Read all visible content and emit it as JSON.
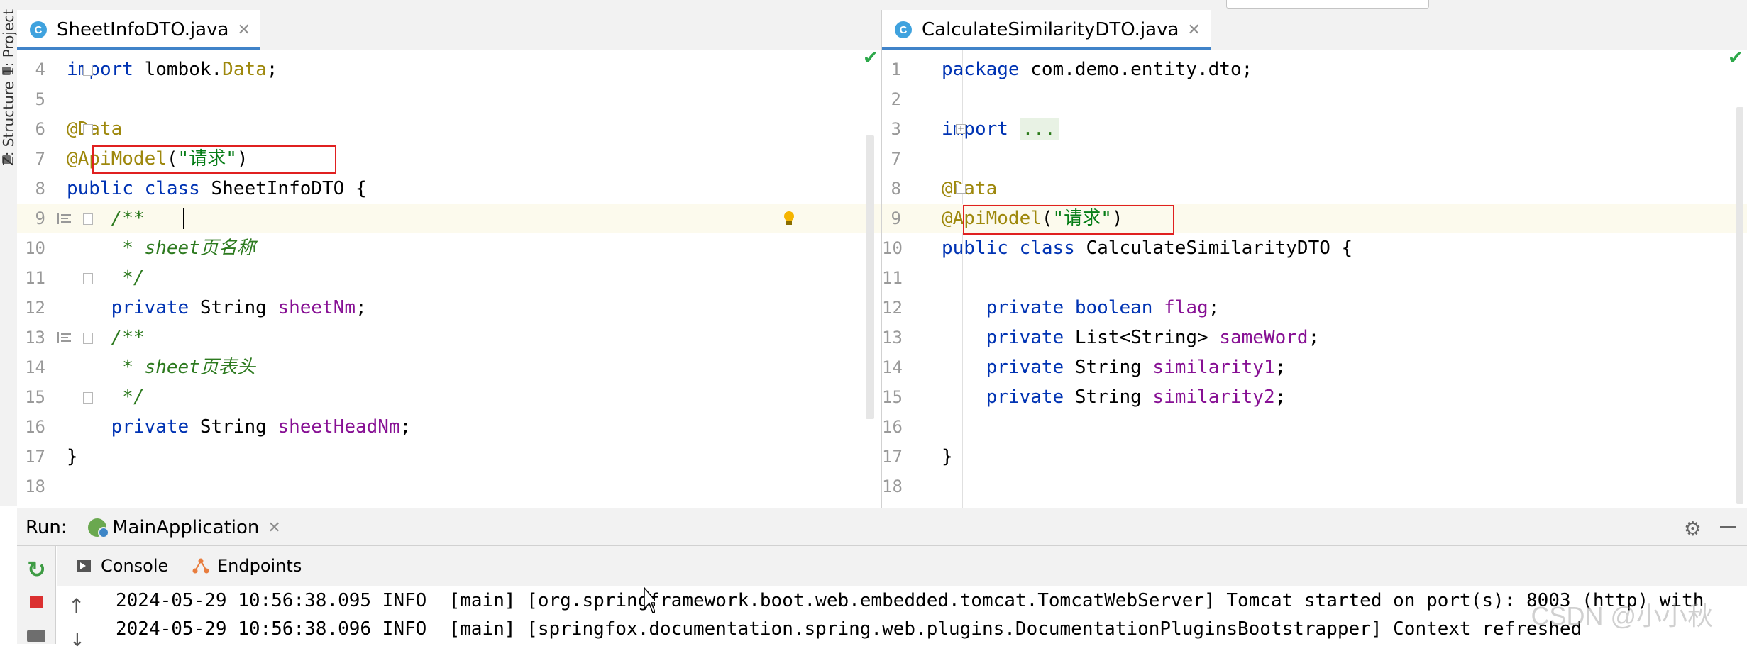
{
  "tool_windows": {
    "project": "1: Project",
    "structure": "Z: Structure"
  },
  "left_editor": {
    "tab": {
      "icon": "C",
      "title": "SheetInfoDTO.java",
      "close": "✕"
    },
    "current_line": 9,
    "lines": [
      {
        "num": "4",
        "tokens": [
          {
            "t": "kw",
            "v": "import"
          },
          {
            "t": "",
            "v": " lombok."
          },
          {
            "t": "an",
            "v": "Data"
          },
          {
            "t": "",
            "v": ";"
          }
        ]
      },
      {
        "num": "5",
        "tokens": []
      },
      {
        "num": "6",
        "tokens": [
          {
            "t": "an",
            "v": "@Data"
          }
        ]
      },
      {
        "num": "7",
        "tokens": [
          {
            "t": "an",
            "v": "@ApiModel"
          },
          {
            "t": "",
            "v": "("
          },
          {
            "t": "str",
            "v": "\"请求\""
          },
          {
            "t": "",
            "v": ")"
          }
        ]
      },
      {
        "num": "8",
        "tokens": [
          {
            "t": "kw",
            "v": "public class"
          },
          {
            "t": "",
            "v": " SheetInfoDTO {"
          }
        ]
      },
      {
        "num": "9",
        "tokens": [
          {
            "t": "cm",
            "v": "    /**"
          }
        ]
      },
      {
        "num": "10",
        "tokens": [
          {
            "t": "cm",
            "v": "     * sheet页名称"
          }
        ]
      },
      {
        "num": "11",
        "tokens": [
          {
            "t": "cm",
            "v": "     */"
          }
        ]
      },
      {
        "num": "12",
        "tokens": [
          {
            "t": "kw",
            "v": "    private"
          },
          {
            "t": "",
            "v": " String "
          },
          {
            "t": "fld",
            "v": "sheetNm"
          },
          {
            "t": "",
            "v": ";"
          }
        ]
      },
      {
        "num": "13",
        "tokens": [
          {
            "t": "cm",
            "v": "    /**"
          }
        ]
      },
      {
        "num": "14",
        "tokens": [
          {
            "t": "cm",
            "v": "     * sheet页表头"
          }
        ]
      },
      {
        "num": "15",
        "tokens": [
          {
            "t": "cm",
            "v": "     */"
          }
        ]
      },
      {
        "num": "16",
        "tokens": [
          {
            "t": "kw",
            "v": "    private"
          },
          {
            "t": "",
            "v": " String "
          },
          {
            "t": "fld",
            "v": "sheetHeadNm"
          },
          {
            "t": "",
            "v": ";"
          }
        ]
      },
      {
        "num": "17",
        "tokens": [
          {
            "t": "",
            "v": "}"
          }
        ]
      },
      {
        "num": "18",
        "tokens": []
      }
    ]
  },
  "right_editor": {
    "tab": {
      "icon": "C",
      "title": "CalculateSimilarityDTO.java",
      "close": "✕"
    },
    "current_line": 9,
    "lines": [
      {
        "num": "1",
        "tokens": [
          {
            "t": "kw",
            "v": "package"
          },
          {
            "t": "",
            "v": " com.demo.entity.dto;"
          }
        ]
      },
      {
        "num": "2",
        "tokens": []
      },
      {
        "num": "3",
        "tokens": [
          {
            "t": "kw",
            "v": "import"
          },
          {
            "t": "",
            "v": " "
          },
          {
            "t": "dots",
            "v": "..."
          }
        ]
      },
      {
        "num": "7",
        "tokens": []
      },
      {
        "num": "8",
        "tokens": [
          {
            "t": "an",
            "v": "@Data"
          }
        ]
      },
      {
        "num": "9",
        "tokens": [
          {
            "t": "an",
            "v": "@ApiModel"
          },
          {
            "t": "",
            "v": "("
          },
          {
            "t": "str",
            "v": "\"请求\""
          },
          {
            "t": "",
            "v": ")"
          }
        ]
      },
      {
        "num": "10",
        "tokens": [
          {
            "t": "kw",
            "v": "public class"
          },
          {
            "t": "",
            "v": " CalculateSimilarityDTO {"
          }
        ]
      },
      {
        "num": "11",
        "tokens": []
      },
      {
        "num": "12",
        "tokens": [
          {
            "t": "kw",
            "v": "    private boolean"
          },
          {
            "t": "",
            "v": " "
          },
          {
            "t": "fld",
            "v": "flag"
          },
          {
            "t": "",
            "v": ";"
          }
        ]
      },
      {
        "num": "13",
        "tokens": [
          {
            "t": "kw",
            "v": "    private"
          },
          {
            "t": "",
            "v": " List<String> "
          },
          {
            "t": "fld",
            "v": "sameWord"
          },
          {
            "t": "",
            "v": ";"
          }
        ]
      },
      {
        "num": "14",
        "tokens": [
          {
            "t": "kw",
            "v": "    private"
          },
          {
            "t": "",
            "v": " String "
          },
          {
            "t": "fld",
            "v": "similarity1"
          },
          {
            "t": "",
            "v": ";"
          }
        ]
      },
      {
        "num": "15",
        "tokens": [
          {
            "t": "kw",
            "v": "    private"
          },
          {
            "t": "",
            "v": " String "
          },
          {
            "t": "fld",
            "v": "similarity2"
          },
          {
            "t": "",
            "v": ";"
          }
        ]
      },
      {
        "num": "16",
        "tokens": []
      },
      {
        "num": "17",
        "tokens": [
          {
            "t": "",
            "v": "}"
          }
        ]
      },
      {
        "num": "18",
        "tokens": []
      }
    ]
  },
  "run_panel": {
    "label": "Run:",
    "config_name": "MainApplication",
    "close": "✕",
    "tabs": {
      "console": "Console",
      "endpoints": "Endpoints"
    }
  },
  "console": {
    "lines": [
      "2024-05-29 10:56:38.095 INFO  [main] [org.springframework.boot.web.embedded.tomcat.TomcatWebServer] Tomcat started on port(s): 8003 (http) with",
      "2024-05-29 10:56:38.096 INFO  [main] [springfox.documentation.spring.web.plugins.DocumentationPluginsBootstrapper] Context refreshed"
    ]
  },
  "watermark": "CSDN @小小秋",
  "colors": {
    "keyword": "#0033b3",
    "annotation": "#9e880d",
    "string": "#067d17",
    "field": "#871094",
    "comment": "#2d7a1f",
    "highlight_box": "#e02020",
    "tab_underline": "#4083c9"
  }
}
